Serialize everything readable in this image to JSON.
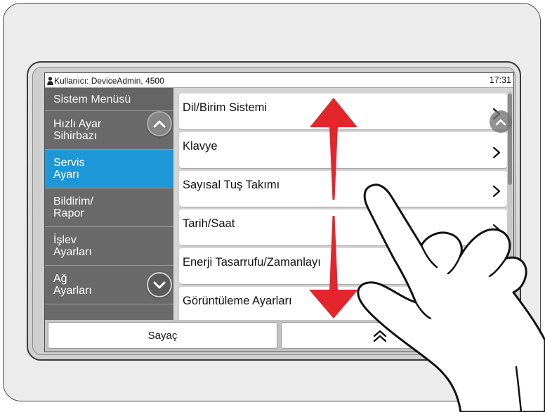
{
  "status_bar": {
    "user_icon": "user-icon",
    "user_text": "Kullanıcı: DeviceAdmin, 4500",
    "time": "17:31"
  },
  "sidebar": {
    "title": "Sistem Menüsü",
    "items": [
      {
        "line1": "Hızlı Ayar",
        "line2": "Sihirbazı",
        "selected": false
      },
      {
        "line1": "Servis",
        "line2": "Ayarı",
        "selected": true
      },
      {
        "line1": "Bildirim/",
        "line2": "Rapor",
        "selected": false
      },
      {
        "line1": "İşlev",
        "line2": "Ayarları",
        "selected": false
      },
      {
        "line1": "Ağ",
        "line2": "Ayarları",
        "selected": false
      }
    ],
    "scroll_up_icon": "chevron-up-icon",
    "scroll_down_icon": "chevron-down-icon"
  },
  "list": {
    "items": [
      {
        "label": "Dil/Birim Sistemi",
        "icon": "chevron-right-icon"
      },
      {
        "label": "Klavye",
        "icon": "chevron-right-icon"
      },
      {
        "label": "Sayısal Tuş Takımı",
        "icon": "chevron-right-icon"
      },
      {
        "label": "Tarih/Saat",
        "icon": "chevron-right-icon"
      },
      {
        "label": "Enerji Tasarrufu/Zamanlayı",
        "icon": "chevron-right-icon"
      },
      {
        "label": "Görüntüleme Ayarları",
        "icon": "chevron-right-icon"
      }
    ],
    "scroll_up_icon": "chevron-up-icon"
  },
  "bottom_bar": {
    "counter_label": "Sayaç",
    "collapse_icon": "double-chevron-up-icon"
  },
  "gesture": {
    "hand_icon": "pointing-hand-icon",
    "arrow_icon": "scroll-arrows-icon"
  },
  "colors": {
    "selected_item": "#1d97d5",
    "sidebar": "#6a6a6a",
    "gesture_arrow": "#e3262b"
  }
}
